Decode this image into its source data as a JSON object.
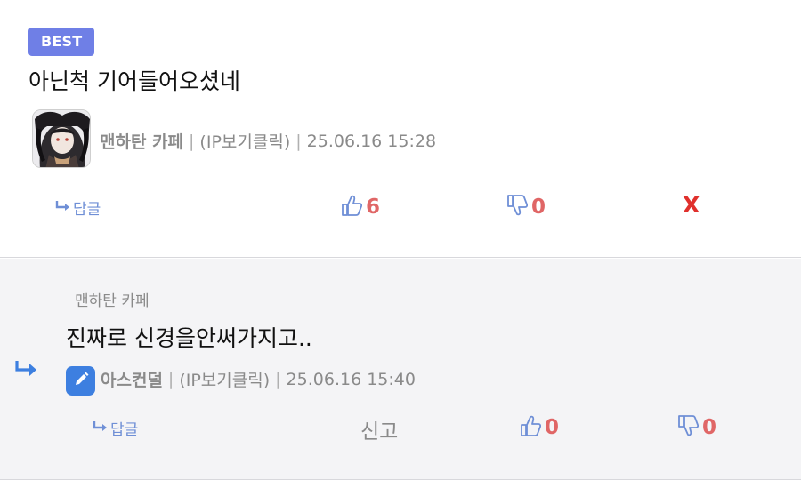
{
  "best_comment": {
    "badge": "BEST",
    "text": "아닌척 기어들어오셨네",
    "author": "맨하탄 카페",
    "ip_label": "(IP보기클릭)",
    "timestamp": "25.06.16 15:28",
    "reply_label": "답글",
    "upvotes": "6",
    "downvotes": "0",
    "delete_label": "X"
  },
  "reply": {
    "parent_author": "맨하탄 카페",
    "text": "진짜로 신경을안써가지고..",
    "author": "아스컨덜",
    "ip_label": "(IP보기클릭)",
    "timestamp": "25.06.16 15:40",
    "reply_label": "답글",
    "report_label": "신고",
    "upvotes": "0",
    "downvotes": "0"
  },
  "separator": "|",
  "colors": {
    "badge": "#6f7fe6",
    "link": "#6f8fd6",
    "count": "#e06666",
    "delete": "#e0302c",
    "meta": "#8a8a8a",
    "reply_bg": "#f4f4f6",
    "pencil_avatar": "#3d7fe0"
  },
  "icons": [
    "reply-arrow-icon",
    "thumbs-up-icon",
    "thumbs-down-icon",
    "pencil-icon",
    "reply-indicator-icon",
    "avatar-image"
  ]
}
